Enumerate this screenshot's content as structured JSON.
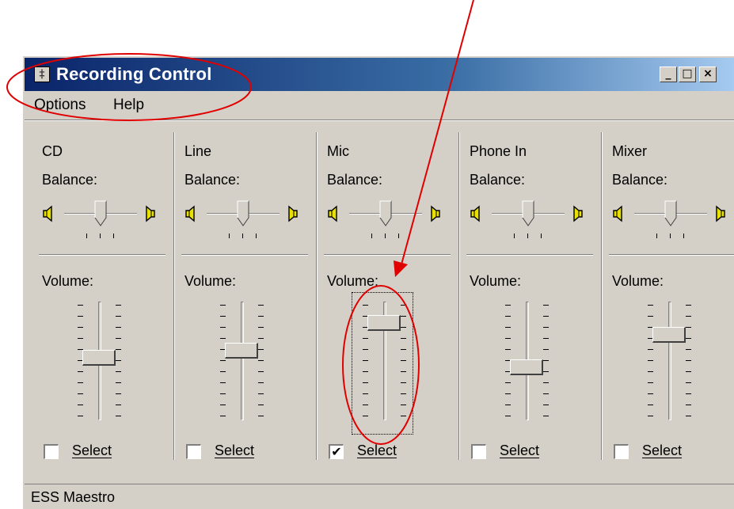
{
  "window": {
    "title": "Recording Control",
    "icon": "mixer-app-icon",
    "controls": {
      "minimize": "_",
      "maximize": "□",
      "close": "×"
    }
  },
  "menu": [
    {
      "label": "Options"
    },
    {
      "label": "Help"
    }
  ],
  "channels": [
    {
      "name": "CD",
      "balance_label": "Balance:",
      "volume_label": "Volume:",
      "select_label": "Select",
      "selected": false,
      "volume_level": 0.55,
      "balance_level": 0.5
    },
    {
      "name": "Line",
      "balance_label": "Balance:",
      "volume_label": "Volume:",
      "select_label": "Select",
      "selected": false,
      "volume_level": 0.62,
      "balance_level": 0.5
    },
    {
      "name": "Mic",
      "balance_label": "Balance:",
      "volume_label": "Volume:",
      "select_label": "Select",
      "selected": true,
      "volume_level": 0.9,
      "balance_level": 0.5
    },
    {
      "name": "Phone In",
      "balance_label": "Balance:",
      "volume_label": "Volume:",
      "select_label": "Select",
      "selected": false,
      "volume_level": 0.45,
      "balance_level": 0.5
    },
    {
      "name": "Mixer",
      "balance_label": "Balance:",
      "volume_label": "Volume:",
      "select_label": "Select",
      "selected": false,
      "volume_level": 0.78,
      "balance_level": 0.5
    }
  ],
  "status": {
    "text": "ESS Maestro"
  },
  "colors": {
    "annotation": "#e00000",
    "titlebar": "#0a246a",
    "face": "#d4d0c8"
  }
}
